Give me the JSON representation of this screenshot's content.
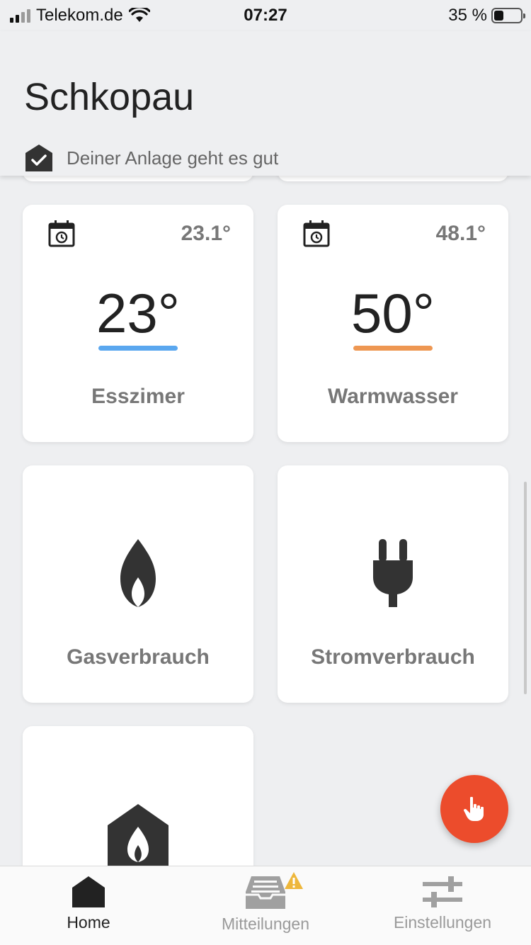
{
  "status_bar": {
    "carrier": "Telekom.de",
    "time": "07:27",
    "battery_percent": "35 %",
    "battery_level": 0.35
  },
  "header": {
    "title": "Schkopau",
    "health_status": "Deiner Anlage geht es gut"
  },
  "cards": {
    "esszimmer": {
      "current_temp": "23.1°",
      "set_temp": "23°",
      "label": "Esszimer",
      "bar_color": "#5aa7ef"
    },
    "warmwasser": {
      "current_temp": "48.1°",
      "set_temp": "50°",
      "label": "Warmwasser",
      "bar_color": "#ee9752"
    },
    "gas": {
      "label": "Gasverbrauch",
      "icon": "flame-icon"
    },
    "strom": {
      "label": "Stromverbrauch",
      "icon": "plug-icon"
    },
    "anlage": {
      "icon": "house-flame-icon"
    }
  },
  "fab": {
    "icon": "hand-pointer-icon",
    "color": "#ec4c2c"
  },
  "bottom_nav": {
    "items": [
      {
        "label": "Home",
        "icon": "home-icon",
        "active": true
      },
      {
        "label": "Mitteilungen",
        "icon": "inbox-icon",
        "active": false,
        "badge": "warning-icon"
      },
      {
        "label": "Einstellungen",
        "icon": "sliders-icon",
        "active": false
      }
    ]
  }
}
